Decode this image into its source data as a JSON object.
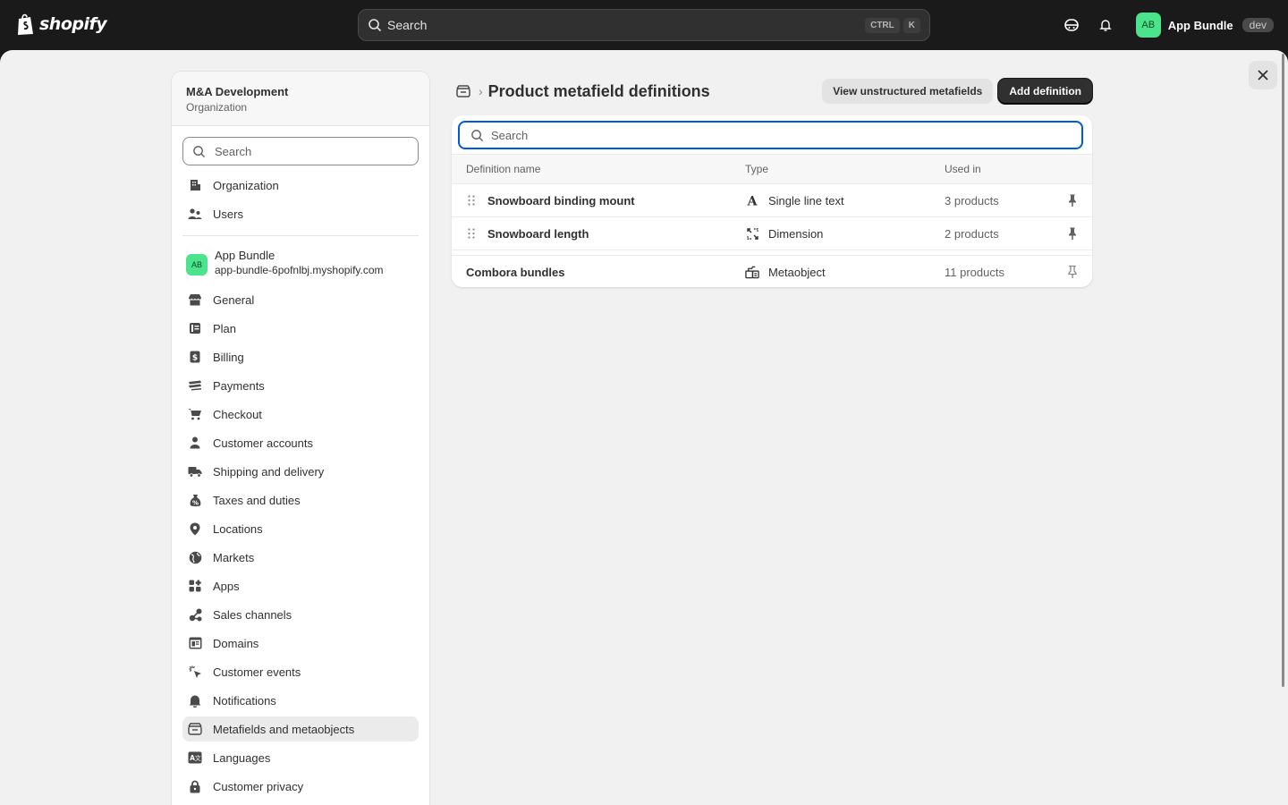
{
  "topbar": {
    "logo_text": "shopify",
    "search_placeholder": "Search",
    "shortcut_keys": [
      "CTRL",
      "K"
    ],
    "store_avatar": "AB",
    "store_name": "App Bundle",
    "store_badge": "dev",
    "icons": [
      "shopify-bag-icon",
      "search-icon",
      "sidekick-icon",
      "bell-icon"
    ]
  },
  "sidebar": {
    "org_name": "M&A Development",
    "org_sub": "Organization",
    "search_placeholder": "Search",
    "org_items": [
      {
        "label": "Organization",
        "icon": "building-icon"
      },
      {
        "label": "Users",
        "icon": "users-icon"
      }
    ],
    "store": {
      "avatar": "AB",
      "name": "App Bundle",
      "domain": "app-bundle-6pofnlbj.myshopify.com"
    },
    "items": [
      {
        "label": "General",
        "icon": "store-icon"
      },
      {
        "label": "Plan",
        "icon": "plan-icon"
      },
      {
        "label": "Billing",
        "icon": "billing-icon"
      },
      {
        "label": "Payments",
        "icon": "payments-icon"
      },
      {
        "label": "Checkout",
        "icon": "cart-icon"
      },
      {
        "label": "Customer accounts",
        "icon": "person-icon"
      },
      {
        "label": "Shipping and delivery",
        "icon": "truck-icon"
      },
      {
        "label": "Taxes and duties",
        "icon": "tax-icon"
      },
      {
        "label": "Locations",
        "icon": "location-icon"
      },
      {
        "label": "Markets",
        "icon": "globe-icon"
      },
      {
        "label": "Apps",
        "icon": "apps-icon"
      },
      {
        "label": "Sales channels",
        "icon": "channels-icon"
      },
      {
        "label": "Domains",
        "icon": "domains-icon"
      },
      {
        "label": "Customer events",
        "icon": "cursor-icon"
      },
      {
        "label": "Notifications",
        "icon": "bell-icon"
      },
      {
        "label": "Metafields and metaobjects",
        "icon": "metafields-icon",
        "active": true
      },
      {
        "label": "Languages",
        "icon": "language-icon"
      },
      {
        "label": "Customer privacy",
        "icon": "lock-icon"
      }
    ]
  },
  "main": {
    "title": "Product metafield definitions",
    "secondary_button": "View unstructured metafields",
    "primary_button": "Add definition",
    "search_placeholder": "Search",
    "columns": [
      "Definition name",
      "Type",
      "Used in"
    ],
    "rows": [
      {
        "name": "Snowboard binding mount",
        "type": "Single line text",
        "type_icon": "text-icon",
        "used_in": "3 products",
        "pinned": true
      },
      {
        "name": "Snowboard length",
        "type": "Dimension",
        "type_icon": "dimension-icon",
        "used_in": "2 products",
        "pinned": true
      },
      {
        "name": "Combora bundles",
        "type": "Metaobject",
        "type_icon": "metaobject-icon",
        "used_in": "11 products",
        "pinned": false
      }
    ]
  }
}
